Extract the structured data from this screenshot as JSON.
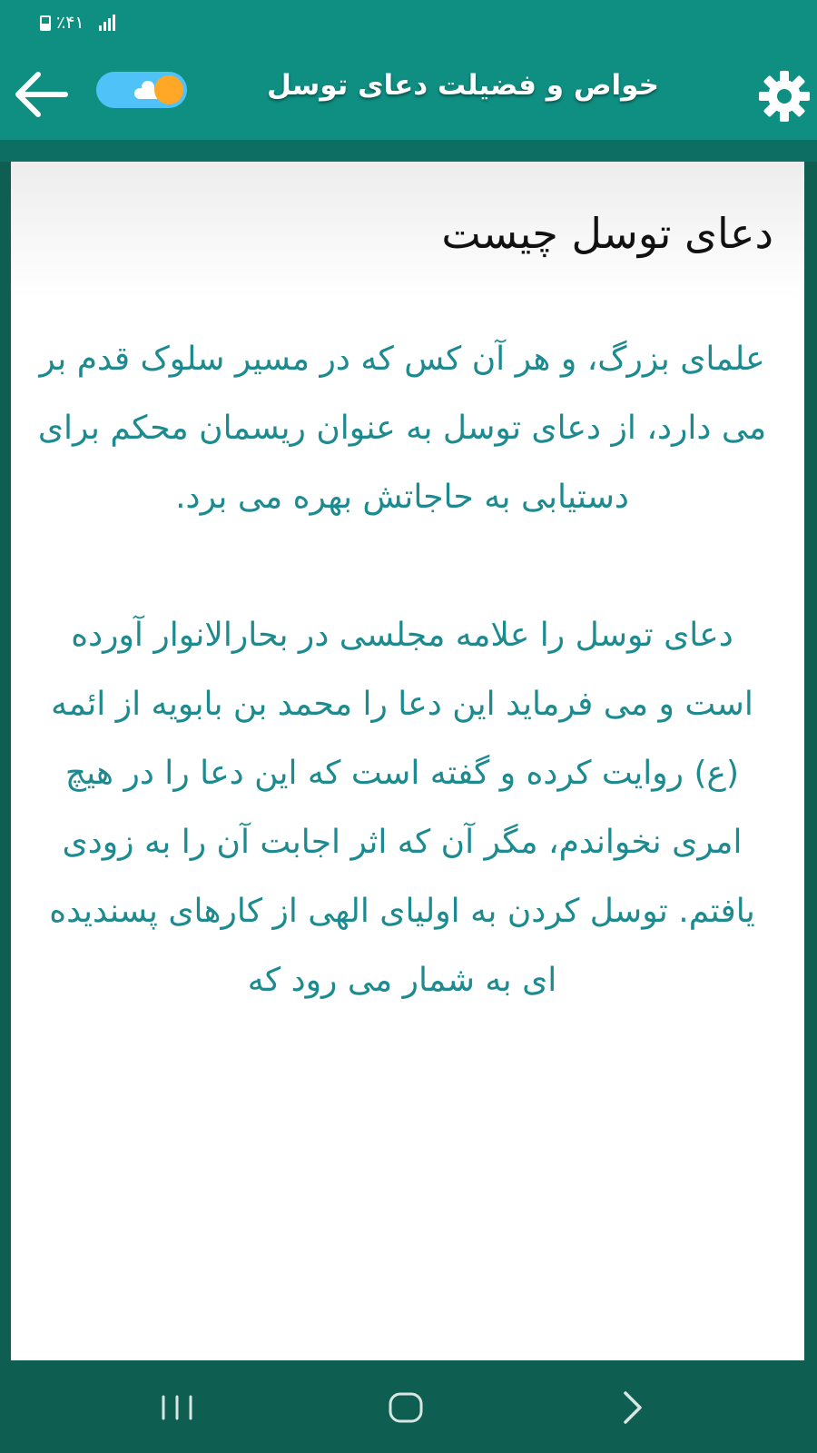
{
  "status_bar": {
    "battery_text": "٪۴۱"
  },
  "app_bar": {
    "title": "خواص و فضیلت دعای توسل",
    "back_icon": "arrow-left-icon",
    "theme_icon": "day-night-toggle",
    "settings_icon": "gear-icon"
  },
  "article": {
    "title": "دعای توسل چیست",
    "paragraphs": [
      "علمای بزرگ، و هر آن کس که در مسیر سلوک قدم بر می دارد، از دعای توسل به عنوان ریسمان محکم برای دستیابی به حاجاتش بهره می برد.",
      "دعای توسل را علامه مجلسی در بحارالانوار آورده است و می فرماید این دعا را محمد بن بابویه از ائمه (ع) روایت کرده و گفته است که این دعا را در هیچ امری نخواندم، مگر آن که اثر اجابت آن را به زودی یافتم. توسل کردن به اولیای الهی از کارهای پسندیده ای به شمار می رود که"
    ]
  },
  "colors": {
    "app_bar": "#0f8f82",
    "nav_bar": "#0f5e52",
    "body_text": "#1c8a8e",
    "title_text": "#111111"
  },
  "nav_bar": {
    "recents_icon": "recents-icon",
    "home_icon": "home-icon",
    "back_icon": "chevron-right-icon"
  }
}
